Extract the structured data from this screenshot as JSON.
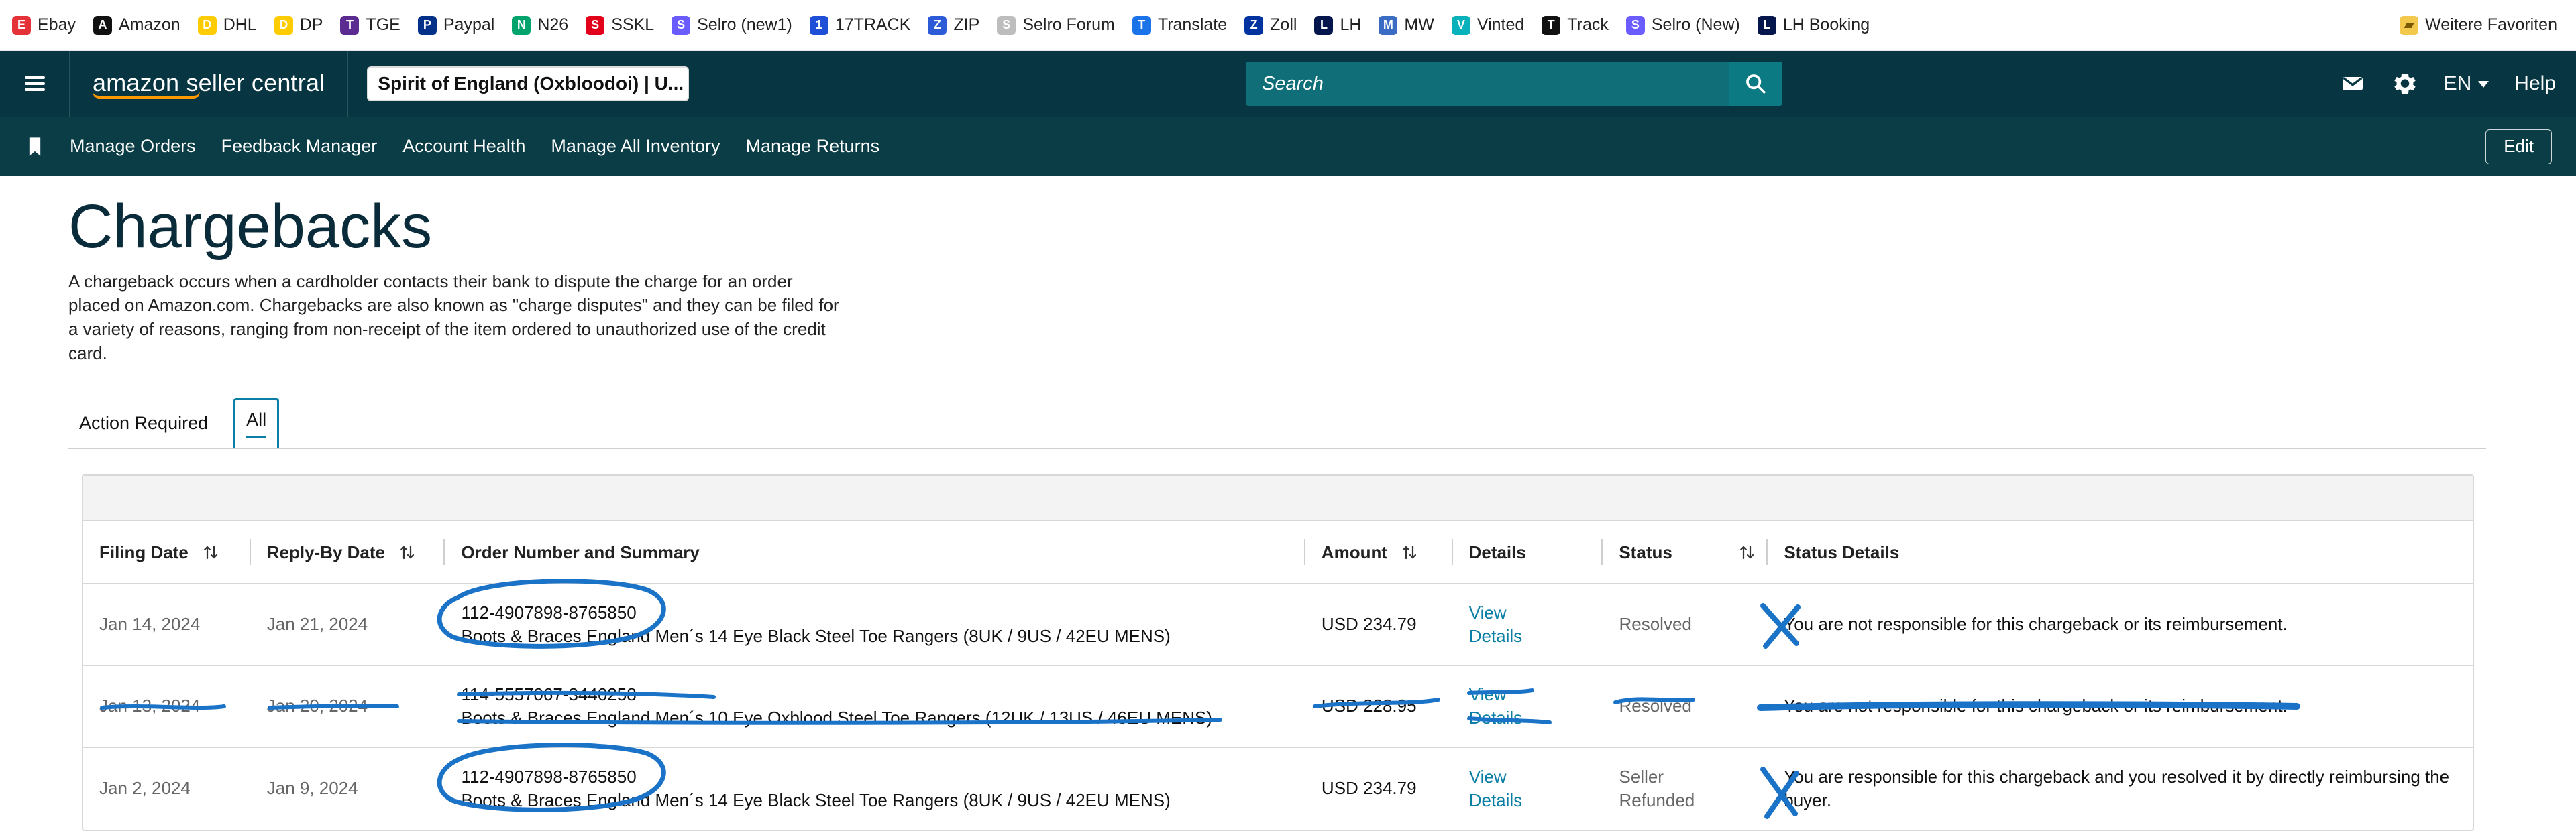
{
  "bookmarks": [
    {
      "name": "ebay-bookmark",
      "label": "Ebay",
      "color": "#e53238"
    },
    {
      "name": "amazon-bookmark",
      "label": "Amazon",
      "color": "#111111"
    },
    {
      "name": "dhl-bookmark",
      "label": "DHL",
      "color": "#ffcc00"
    },
    {
      "name": "dp-bookmark",
      "label": "DP",
      "color": "#ffcc00"
    },
    {
      "name": "tge-bookmark",
      "label": "TGE",
      "color": "#5b2b91"
    },
    {
      "name": "paypal-bookmark",
      "label": "Paypal",
      "color": "#003087"
    },
    {
      "name": "n26-bookmark",
      "label": "N26",
      "color": "#00a36c"
    },
    {
      "name": "sskl-bookmark",
      "label": "SSKL",
      "color": "#e2001a"
    },
    {
      "name": "selro-new1-bookmark",
      "label": "Selro (new1)",
      "color": "#6b5cff"
    },
    {
      "name": "17track-bookmark",
      "label": "17TRACK",
      "color": "#1f4fd6"
    },
    {
      "name": "zip-bookmark",
      "label": "ZIP",
      "color": "#2d5bd8"
    },
    {
      "name": "selro-forum-bookmark",
      "label": "Selro Forum",
      "color": "#bdbdbd"
    },
    {
      "name": "translate-bookmark",
      "label": "Translate",
      "color": "#1a73e8"
    },
    {
      "name": "zoll-bookmark",
      "label": "Zoll",
      "color": "#0033a0"
    },
    {
      "name": "lh-bookmark",
      "label": "LH",
      "color": "#05164d"
    },
    {
      "name": "mw-bookmark",
      "label": "MW",
      "color": "#3b6cc4"
    },
    {
      "name": "vinted-bookmark",
      "label": "Vinted",
      "color": "#09b1ba"
    },
    {
      "name": "track-bookmark",
      "label": "Track",
      "color": "#111111"
    },
    {
      "name": "selro-new-bookmark",
      "label": "Selro (New)",
      "color": "#6b5cff"
    },
    {
      "name": "lh-booking-bookmark",
      "label": "LH Booking",
      "color": "#05164d"
    }
  ],
  "bookmarks_right": {
    "label": "Weitere Favoriten"
  },
  "topbar": {
    "logo_text": "amazon seller central",
    "store_selector": "Spirit of England (Oxbloodoi) | U...",
    "search_placeholder": "Search",
    "lang": "EN",
    "help": "Help"
  },
  "navbar": {
    "links": [
      "Manage Orders",
      "Feedback Manager",
      "Account Health",
      "Manage All Inventory",
      "Manage Returns"
    ],
    "edit": "Edit"
  },
  "page": {
    "title": "Chargebacks",
    "description": "A chargeback occurs when a cardholder contacts their bank to dispute the charge for an order placed on Amazon.com. Chargebacks are also known as \"charge disputes\" and they can be filed for a variety of reasons, ranging from non-receipt of the item ordered to unauthorized use of the credit card.",
    "tabs": [
      {
        "label": "Action Required"
      },
      {
        "label": "All"
      }
    ]
  },
  "table": {
    "headers": {
      "filing_date": "Filing Date",
      "reply_by": "Reply-By Date",
      "order": "Order Number and Summary",
      "amount": "Amount",
      "details": "Details",
      "status": "Status",
      "status_details": "Status Details"
    },
    "rows": [
      {
        "filing_date": "Jan 14, 2024",
        "reply_by": "Jan 21, 2024",
        "order_number": "112-4907898-8765850",
        "order_summary": "Boots & Braces England Men´s 14 Eye Black Steel Toe Rangers (8UK / 9US / 42EU MENS)",
        "amount": "USD 234.79",
        "details_line1": "View",
        "details_line2": "Details",
        "status_line1": "Resolved",
        "status_line2": "",
        "status_details": "You are not responsible for this chargeback or its reimbursement."
      },
      {
        "filing_date": "Jan 13, 2024",
        "reply_by": "Jan 20, 2024",
        "order_number": "114-5557067-3440258",
        "order_summary": "Boots & Braces England Men´s 10 Eye Oxblood Steel Toe Rangers (12UK / 13US / 46EU MENS)",
        "amount": "USD 228.95",
        "details_line1": "View",
        "details_line2": "Details",
        "status_line1": "Resolved",
        "status_line2": "",
        "status_details": "You are not responsible for this chargeback or its reimbursement."
      },
      {
        "filing_date": "Jan 2, 2024",
        "reply_by": "Jan 9, 2024",
        "order_number": "112-4907898-8765850",
        "order_summary": "Boots & Braces England Men´s 14 Eye Black Steel Toe Rangers (8UK / 9US / 42EU MENS)",
        "amount": "USD 234.79",
        "details_line1": "View",
        "details_line2": "Details",
        "status_line1": "Seller",
        "status_line2": "Refunded",
        "status_details": "You are responsible for this chargeback and you resolved it by directly reimbursing the buyer."
      }
    ]
  }
}
